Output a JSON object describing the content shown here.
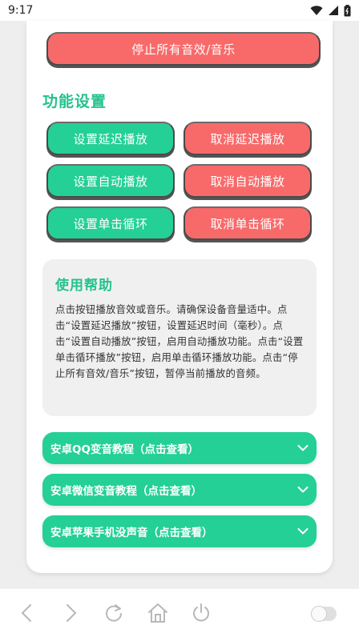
{
  "status": {
    "time": "9:17"
  },
  "actions": {
    "stop_all": "停止所有音效/音乐"
  },
  "settings": {
    "title": "功能设置",
    "set_delay": "设置延迟播放",
    "cancel_delay": "取消延迟播放",
    "set_auto": "设置自动播放",
    "cancel_auto": "取消自动播放",
    "set_loop": "设置单击循环",
    "cancel_loop": "取消单击循环"
  },
  "help": {
    "title": "使用帮助",
    "text": "点击按钮播放音效或音乐。请确保设备音量适中。点击“设置延迟播放”按钮，设置延迟时间（毫秒）。点击“设置自动播放”按钮，启用自动播放功能。点击“设置单击循环播放”按钮，启用单击循环播放功能。点击“停止所有音效/音乐”按钮，暂停当前播放的音频。"
  },
  "tutorials": [
    {
      "label": "安卓QQ变音教程（点击查看）"
    },
    {
      "label": "安卓微信变音教程（点击查看）"
    },
    {
      "label": "安卓苹果手机没声音（点击查看）"
    }
  ],
  "colors": {
    "green": "#24d095",
    "red": "#f86a6a",
    "title_green": "#24c28c"
  },
  "icons": {
    "status": [
      "wifi-icon",
      "signal-icon",
      "battery-icon"
    ],
    "nav": [
      "back-icon",
      "forward-icon",
      "refresh-icon",
      "home-icon",
      "power-icon"
    ]
  }
}
